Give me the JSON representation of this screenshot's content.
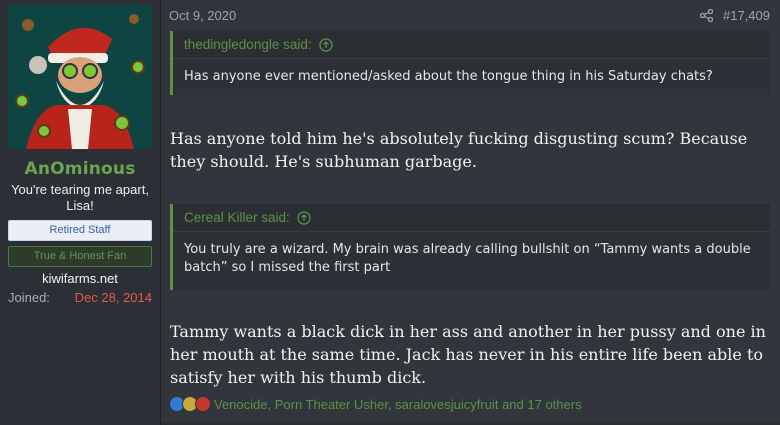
{
  "user": {
    "name": "AnOminous",
    "title": "You're tearing me apart, Lisa!",
    "banners": [
      "Retired Staff",
      "True & Honest Fan"
    ],
    "site": "kiwifarms.net",
    "joined_label": "Joined:",
    "joined_value": "Dec 28, 2014"
  },
  "post": {
    "date": "Oct 9, 2020",
    "number": "#17,409",
    "quotes": [
      {
        "author": "thedingledongle said:",
        "text": "Has anyone ever mentioned/asked about the tongue thing in his Saturday chats?"
      },
      {
        "author": "Cereal Killer said:",
        "text": "You truly are a wizard. My brain was already calling bullshit on “Tammy wants a double batch” so I missed the first part"
      }
    ],
    "paragraphs": [
      "Has anyone told him he's absolutely fucking disgusting scum? Because they should. He's subhuman garbage.",
      "Tammy wants a black dick in her ass and another in her pussy and one in her mouth at the same time. Jack has never in his entire life been able to satisfy her with his thumb dick."
    ],
    "reactions_text": "Venocide, Porn Theater Usher, saralovesjuicyfruit and 17 others",
    "reaction_icons": [
      "like-icon",
      "puzzle-icon",
      "heart-icon"
    ]
  },
  "colors": {
    "accent_green": "#5f9148",
    "username_green": "#6aa54f",
    "joined_red": "#e25a4e"
  }
}
